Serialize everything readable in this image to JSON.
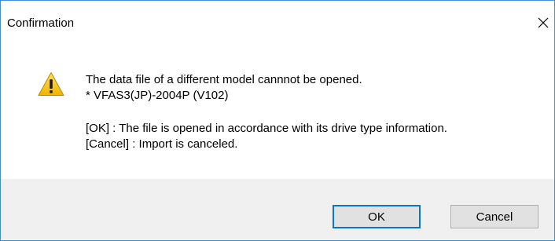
{
  "dialog": {
    "title": "Confirmation",
    "icon": "warning-icon",
    "message_lines": [
      "The data file of a different model cannnot be opened.",
      "* VFAS3(JP)-2004P (V102)",
      "[OK] : The file is opened in accordance with its drive type information.",
      "[Cancel] : Import is canceled."
    ],
    "buttons": {
      "ok_label": "OK",
      "cancel_label": "Cancel"
    }
  },
  "colors": {
    "border": "#3c8fd6",
    "footer_bg": "#f0f0f0",
    "default_button_border": "#0078d7",
    "warning_fill": "#f5c400"
  }
}
